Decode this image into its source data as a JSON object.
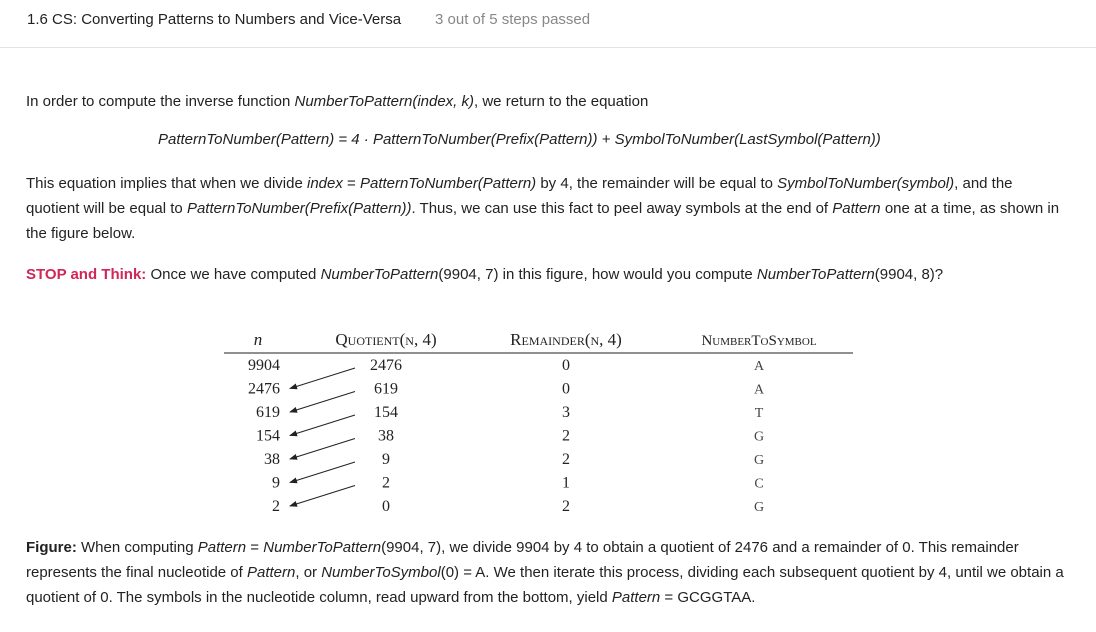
{
  "header": {
    "title": "1.6 CS: Converting Patterns to Numbers and Vice-Versa",
    "steps": "3 out of 5 steps passed"
  },
  "intro": {
    "text_before": "In order to compute the inverse function ",
    "func": "NumberToPattern(index, k)",
    "text_after": ", we return to the equation"
  },
  "equation": "PatternToNumber(Pattern) = 4 · PatternToNumber(Prefix(Pattern)) + SymbolToNumber(LastSymbol(Pattern))",
  "paragraph": {
    "t1": "This equation implies that when we divide ",
    "i1": "index",
    "t2": " = ",
    "i2": "PatternToNumber(Pattern)",
    "t3": " by 4, the remainder will be equal to ",
    "i3": "SymbolToNumber(symbol)",
    "t4": ", and the quotient will be equal to ",
    "i4": "PatternToNumber(Prefix(Pattern))",
    "t5": ". Thus, we can use this fact to peel away symbols at the end of ",
    "i5": "Pattern",
    "t6": " one at a time, as shown in the figure below."
  },
  "stop": {
    "label": "STOP and Think:",
    "t1": " Once we have computed ",
    "i1": "NumberToPattern",
    "t2": "(9904, 7) in this figure, how would you compute ",
    "i2": "NumberToPattern",
    "t3": "(9904, 8)?"
  },
  "table": {
    "headers": {
      "n": "n",
      "quotient": "Quotient(n, 4)",
      "remainder": "Remainder(n, 4)",
      "symbol": "NumberToSymbol"
    },
    "rows": [
      {
        "n": "9904",
        "q": "2476",
        "r": "0",
        "s": "A"
      },
      {
        "n": "2476",
        "q": "619",
        "r": "0",
        "s": "A"
      },
      {
        "n": "619",
        "q": "154",
        "r": "3",
        "s": "T"
      },
      {
        "n": "154",
        "q": "38",
        "r": "2",
        "s": "G"
      },
      {
        "n": "38",
        "q": "9",
        "r": "2",
        "s": "G"
      },
      {
        "n": "9",
        "q": "2",
        "r": "1",
        "s": "C"
      },
      {
        "n": "2",
        "q": "0",
        "r": "2",
        "s": "G"
      }
    ]
  },
  "caption": {
    "label": "Figure:",
    "t1": " When computing ",
    "i1": "Pattern",
    "t2": " = ",
    "i2": "NumberToPattern",
    "t3": "(9904, 7), we divide 9904 by 4 to obtain a quotient of 2476 and a remainder of 0. This remainder represents the final nucleotide of ",
    "i3": "Pattern",
    "t4": ", or ",
    "i4": "NumberToSymbol",
    "t5": "(0) = A. We then iterate this process, dividing each subsequent quotient by 4, until we obtain a quotient of 0. The symbols in the nucleotide column, read upward from the bottom, yield ",
    "i5": "Pattern",
    "t6": " = GCGGTAA."
  }
}
